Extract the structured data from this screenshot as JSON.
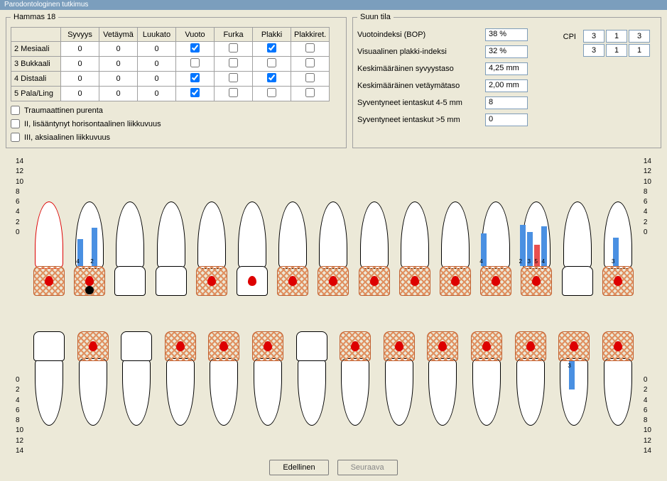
{
  "title": "Parodontologinen tutkimus",
  "hammas": {
    "legend": "Hammas 18",
    "cols": [
      "Syvyys",
      "Vetäymä",
      "Luukato",
      "Vuoto",
      "Furka",
      "Plakki",
      "Plakkiret."
    ],
    "rows": [
      {
        "hdr": "2 Mesiaali",
        "vals": [
          "0",
          "0",
          "0"
        ],
        "chk": [
          true,
          false,
          true,
          false
        ]
      },
      {
        "hdr": "3 Bukkaali",
        "vals": [
          "0",
          "0",
          "0"
        ],
        "chk": [
          false,
          false,
          false,
          false
        ]
      },
      {
        "hdr": "4 Distaali",
        "vals": [
          "0",
          "0",
          "0"
        ],
        "chk": [
          true,
          false,
          true,
          false
        ]
      },
      {
        "hdr": "5 Pala/Ling",
        "vals": [
          "0",
          "0",
          "0"
        ],
        "chk": [
          true,
          false,
          false,
          false
        ]
      }
    ],
    "checks": [
      {
        "label": "Traumaattinen purenta",
        "v": false
      },
      {
        "label": "II, lisääntynyt horisontaalinen liikkuvuus",
        "v": false
      },
      {
        "label": "III, aksiaalinen liikkuvuus",
        "v": false
      }
    ]
  },
  "suun": {
    "legend": "Suun tila",
    "rows": [
      {
        "label": "Vuotoindeksi (BOP)",
        "val": "38 %"
      },
      {
        "label": "Visuaalinen plakki-indeksi",
        "val": "32 %"
      },
      {
        "label": "Keskimääräinen syvyystaso",
        "val": "4,25 mm"
      },
      {
        "label": "Keskimääräinen vetäymätaso",
        "val": "2,00 mm"
      },
      {
        "label": "Syventyneet ientaskut 4-5 mm",
        "val": "8"
      },
      {
        "label": "Syventyneet ientaskut >5 mm",
        "val": "0"
      }
    ],
    "cpi": {
      "label": "CPI",
      "cells": [
        "3",
        "1",
        "3",
        "3",
        "1",
        "1"
      ]
    }
  },
  "scale_top": [
    "14",
    "12",
    "10",
    "8",
    "6",
    "4",
    "2",
    "0"
  ],
  "scale_bot": [
    "0",
    "2",
    "4",
    "6",
    "8",
    "10",
    "12",
    "14"
  ],
  "upper_teeth": [
    {
      "crown": "hatch",
      "rootClass": "red",
      "blood": true
    },
    {
      "crown": "hatch",
      "blood": true,
      "black": true,
      "bars": [
        {
          "l": 8,
          "h": 38
        },
        {
          "l": 28,
          "h": 54
        }
      ],
      "nums": [
        {
          "t": "4",
          "l": 6
        },
        {
          "t": "2",
          "l": 26
        }
      ]
    },
    {
      "crown": "white"
    },
    {
      "crown": "white"
    },
    {
      "crown": "hatch",
      "blood": true
    },
    {
      "crown": "white",
      "blood": true
    },
    {
      "crown": "hatch",
      "blood": true
    },
    {
      "crown": "hatch",
      "blood": true
    },
    {
      "crown": "hatch",
      "blood": true
    },
    {
      "crown": "hatch",
      "blood": true
    },
    {
      "crown": "hatch",
      "blood": true
    },
    {
      "crown": "hatch",
      "blood": true,
      "bars": [
        {
          "l": 4,
          "h": 46
        }
      ],
      "nums": [
        {
          "t": "4",
          "l": 2
        }
      ]
    },
    {
      "crown": "hatch",
      "blood": true,
      "bars": [
        {
          "l": 2,
          "h": 58
        },
        {
          "l": 12,
          "h": 48
        },
        {
          "l": 22,
          "h": 30,
          "red": true
        },
        {
          "l": 32,
          "h": 56
        }
      ],
      "nums": [
        {
          "t": "2",
          "l": 0
        },
        {
          "t": "3",
          "l": 12
        },
        {
          "t": "5",
          "l": 22
        },
        {
          "t": "4",
          "l": 32
        }
      ]
    },
    {
      "crown": "white"
    },
    {
      "crown": "hatch",
      "blood": true,
      "bars": [
        {
          "l": 18,
          "h": 40
        }
      ],
      "nums": [
        {
          "t": "3",
          "l": 16
        }
      ]
    }
  ],
  "lower_teeth": [
    {
      "crown": "white"
    },
    {
      "crown": "hatch",
      "blood": true
    },
    {
      "crown": "white"
    },
    {
      "crown": "hatch",
      "blood": true
    },
    {
      "crown": "hatch",
      "blood": true
    },
    {
      "crown": "hatch",
      "blood": true
    },
    {
      "crown": "white"
    },
    {
      "crown": "hatch",
      "blood": true
    },
    {
      "crown": "hatch",
      "blood": true
    },
    {
      "crown": "hatch",
      "blood": true
    },
    {
      "crown": "hatch",
      "blood": true
    },
    {
      "crown": "hatch",
      "blood": true
    },
    {
      "crown": "hatch",
      "blood": true,
      "bars": [
        {
          "l": 18,
          "h": 40
        }
      ],
      "nums": [
        {
          "t": "3",
          "l": 16
        }
      ]
    },
    {
      "crown": "hatch",
      "blood": true
    }
  ],
  "buttons": {
    "prev": "Edellinen",
    "next": "Seuraava"
  }
}
